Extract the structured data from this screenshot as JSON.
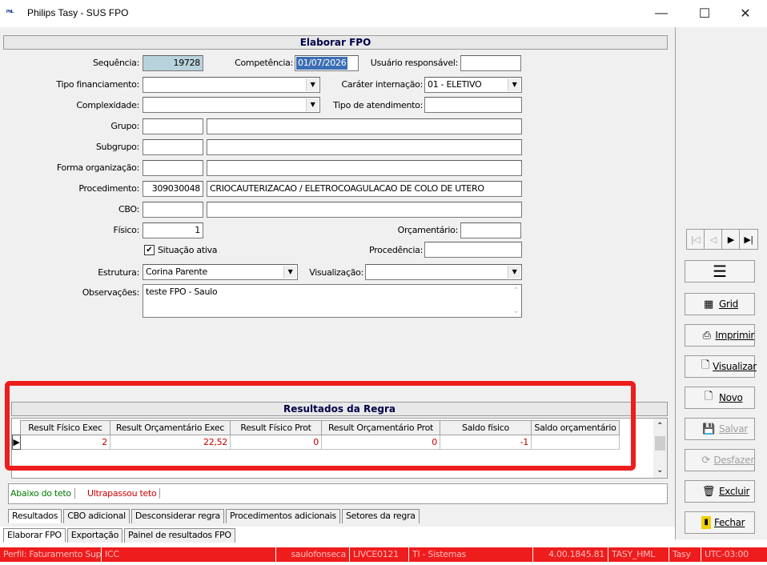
{
  "window": {
    "logo": "ᴾʰᴵᴸ",
    "title": "Philips Tasy - SUS FPO",
    "minimize": "—",
    "maximize": "☐",
    "close": "✕"
  },
  "form": {
    "header": "Elaborar FPO",
    "sequencia_label": "Sequência:",
    "sequencia_value": "19728",
    "competencia_label": "Competência:",
    "competencia_value": "01/07/2026",
    "usuario_label": "Usuário responsável:",
    "usuario_value": "",
    "tipo_financiamento_label": "Tipo financiamento:",
    "tipo_financiamento_value": "",
    "carater_label": "Caráter internação:",
    "carater_value": "01 - ELETIVO",
    "complexidade_label": "Complexidade:",
    "complexidade_value": "",
    "tipo_atendimento_label": "Tipo de atendimento:",
    "tipo_atendimento_value": "",
    "grupo_label": "Grupo:",
    "subgrupo_label": "Subgrupo:",
    "forma_label": "Forma organização:",
    "procedimento_label": "Procedimento:",
    "procedimento_code": "309030048",
    "procedimento_desc": "CRIOCAUTERIZACAO / ELETROCOAGULACAO DE COLO DE UTERO",
    "cbo_label": "CBO:",
    "fisico_label": "Físico:",
    "fisico_value": "1",
    "orcamentario_label": "Orçamentário:",
    "orcamentario_value": "",
    "situacao_label": "Situação ativa",
    "procedencia_label": "Procedência:",
    "estrutura_label": "Estrutura:",
    "estrutura_value": "Corina Parente",
    "visualizacao_label": "Visualização:",
    "visualizacao_value": "",
    "observacoes_label": "Observações:",
    "observacoes_value": "teste FPO - Saulo"
  },
  "results": {
    "header": "Resultados da Regra",
    "columns": [
      "Result Físico Exec",
      "Result Orçamentário Exec",
      "Result Físico Prot",
      "Result Orçamentário Prot",
      "Saldo físico",
      "Saldo orçamentário"
    ],
    "rows": [
      [
        "2",
        "22,52",
        "0",
        "0",
        "-1",
        ""
      ]
    ],
    "legend_below": "Abaixo do teto",
    "legend_above": "Ultrapassou teto",
    "color_below": "#007a00",
    "color_above": "#d00000"
  },
  "inner_tabs": [
    "Resultados",
    "CBO adicional",
    "Desconsiderar regra",
    "Procedimentos adicionais",
    "Setores da regra"
  ],
  "outer_tabs": [
    "Elaborar FPO",
    "Exportação",
    "Painel de resultados FPO"
  ],
  "side": {
    "nav": [
      "|◁",
      "◁",
      "▶",
      "▶|"
    ],
    "menu": "☰",
    "buttons": [
      {
        "icon": "▦",
        "label": "Grid"
      },
      {
        "icon": "⎙",
        "label": "Imprimir"
      },
      {
        "icon": "🗋",
        "label": "Visualizar"
      },
      {
        "icon": "🗋",
        "label": "Novo"
      },
      {
        "icon": "💾",
        "label": "Salvar"
      },
      {
        "icon": "⟳",
        "label": "Desfazer"
      },
      {
        "icon": "🗑",
        "label": "Excluir"
      },
      {
        "icon": "▮",
        "label": "Fechar"
      }
    ]
  },
  "status": [
    "Perfil: Faturamento Sup",
    "ICC",
    "",
    "saulofonseca",
    "LIVCE0121",
    "TI - Sistemas",
    "",
    "4.00.1845.81",
    "TASY_HML",
    "Tasy",
    "UTC-03:00"
  ]
}
